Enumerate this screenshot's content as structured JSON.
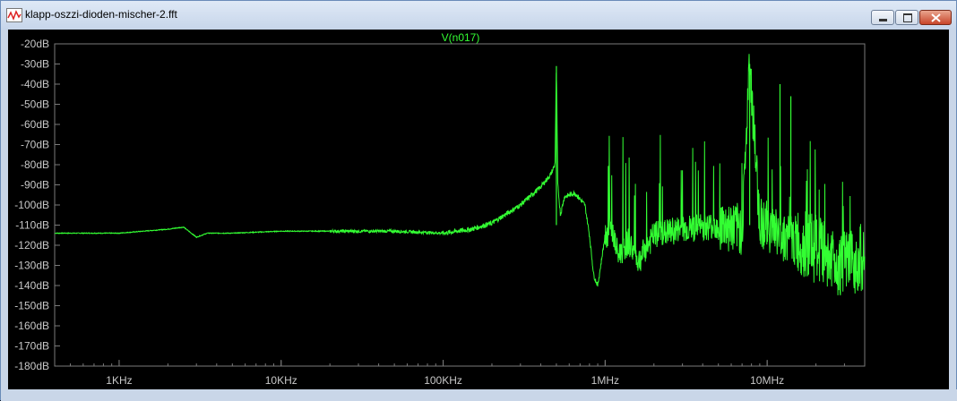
{
  "window": {
    "title": "klapp-oszzi-dioden-mischer-2.fft",
    "controls": {
      "minimize": "minimize",
      "maximize": "maximize",
      "close": "close"
    }
  },
  "colors": {
    "trace": "#33ff33",
    "axis": "#888888",
    "label": "#c8c8c8",
    "background": "#000000"
  },
  "chart_data": {
    "type": "line",
    "title": "V(n017)",
    "xlabel": "",
    "ylabel": "",
    "x_scale": "log",
    "xlim_hz": [
      400,
      40000000
    ],
    "ylim_db": [
      -180,
      -20
    ],
    "x_ticks": [
      {
        "value": 1000,
        "label": "1KHz"
      },
      {
        "value": 10000,
        "label": "10KHz"
      },
      {
        "value": 100000,
        "label": "100KHz"
      },
      {
        "value": 1000000,
        "label": "1MHz"
      },
      {
        "value": 10000000,
        "label": "10MHz"
      }
    ],
    "y_ticks": [
      {
        "value": -20,
        "label": "-20dB"
      },
      {
        "value": -30,
        "label": "-30dB"
      },
      {
        "value": -40,
        "label": "-40dB"
      },
      {
        "value": -50,
        "label": "-50dB"
      },
      {
        "value": -60,
        "label": "-60dB"
      },
      {
        "value": -70,
        "label": "-70dB"
      },
      {
        "value": -80,
        "label": "-80dB"
      },
      {
        "value": -90,
        "label": "-90dB"
      },
      {
        "value": -100,
        "label": "-100dB"
      },
      {
        "value": -110,
        "label": "-110dB"
      },
      {
        "value": -120,
        "label": "-120dB"
      },
      {
        "value": -130,
        "label": "-130dB"
      },
      {
        "value": -140,
        "label": "-140dB"
      },
      {
        "value": -150,
        "label": "-150dB"
      },
      {
        "value": -160,
        "label": "-160dB"
      },
      {
        "value": -170,
        "label": "-170dB"
      },
      {
        "value": -180,
        "label": "-180dB"
      }
    ],
    "series": [
      {
        "name": "V(n017)",
        "x": [
          400,
          1000,
          2000,
          2500,
          3000,
          3500,
          5000,
          10000,
          20000,
          50000,
          100000,
          150000,
          200000,
          300000,
          400000,
          460000,
          490000,
          500000,
          510000,
          530000,
          560000,
          650000,
          750000,
          800000,
          850000,
          900000,
          1000000,
          1100000,
          1200000,
          1400000,
          1600000,
          2000000,
          3000000,
          5000000,
          7000000,
          7800000,
          9000000,
          12000000,
          20000000,
          30000000,
          40000000
        ],
        "y": [
          -114,
          -114,
          -112,
          -111,
          -116,
          -114,
          -114,
          -113,
          -113,
          -113,
          -114,
          -112,
          -109,
          -100,
          -91,
          -85,
          -80,
          -31,
          -90,
          -105,
          -96,
          -94,
          -100,
          -115,
          -135,
          -140,
          -115,
          -112,
          -125,
          -118,
          -128,
          -115,
          -112,
          -110,
          -112,
          -30,
          -108,
          -115,
          -122,
          -130,
          -125
        ]
      }
    ],
    "peaks_db": [
      {
        "x": 500000,
        "y": -31
      },
      {
        "x": 7800000,
        "y": -30
      },
      {
        "x": 12000000,
        "y": -40
      },
      {
        "x": 14000000,
        "y": -46
      }
    ],
    "grid": false,
    "legend": "none"
  }
}
